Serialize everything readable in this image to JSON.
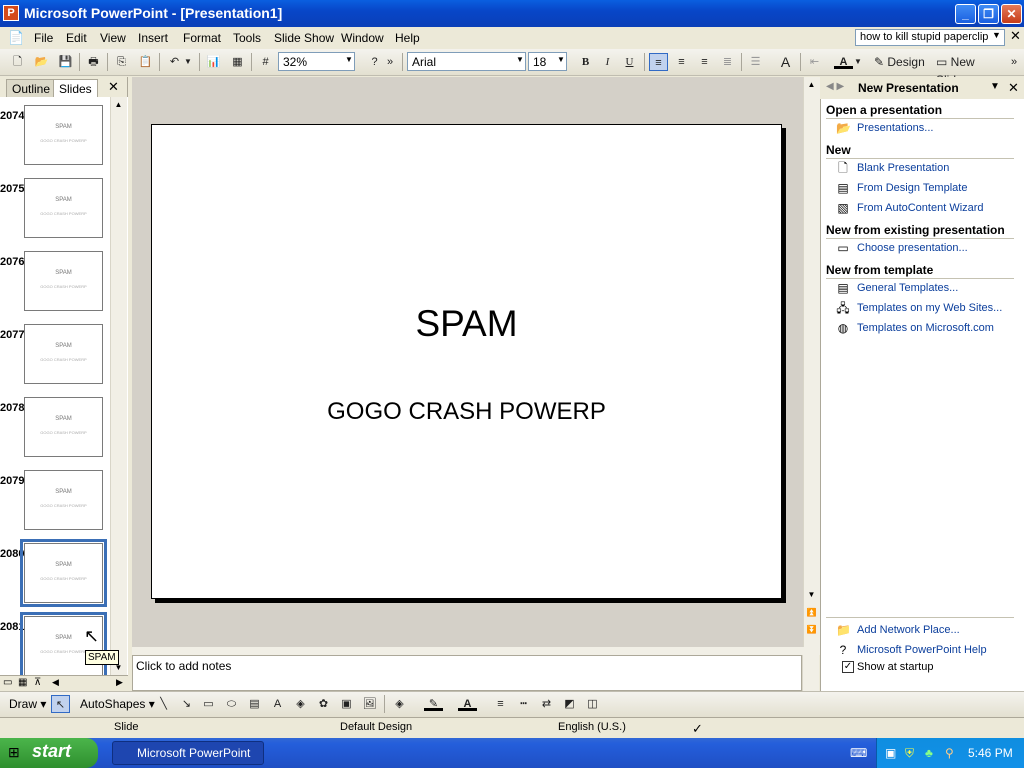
{
  "window": {
    "title": "Microsoft PowerPoint - [Presentation1]",
    "minimize": "_",
    "restore": "❐",
    "close": "✕"
  },
  "menu": {
    "items": [
      "File",
      "Edit",
      "View",
      "Insert",
      "Format",
      "Tools",
      "Slide Show",
      "Window",
      "Help"
    ],
    "ask_question": "how to kill stupid paperclip",
    "close_doc": "✕"
  },
  "toolbar": {
    "zoom": "32%",
    "font": "Arial",
    "size": "18",
    "bold": "B",
    "italic": "I",
    "underline": "U",
    "design": "Design",
    "new_slide": "New Slide",
    "more": "»"
  },
  "left_pane": {
    "tab_outline": "Outline",
    "tab_slides": "Slides",
    "close": "✕",
    "slides": [
      {
        "num": "2074",
        "title": "SPAM",
        "sub": "GOGO CRASH POWERP"
      },
      {
        "num": "2075",
        "title": "SPAM",
        "sub": "GOGO CRASH POWERP"
      },
      {
        "num": "2076",
        "title": "SPAM",
        "sub": "GOGO CRASH POWERP"
      },
      {
        "num": "2077",
        "title": "SPAM",
        "sub": "GOGO CRASH POWERP"
      },
      {
        "num": "2078",
        "title": "SPAM",
        "sub": "GOGO CRASH POWERP"
      },
      {
        "num": "2079",
        "title": "SPAM",
        "sub": "GOGO CRASH POWERP"
      },
      {
        "num": "2080",
        "title": "SPAM",
        "sub": "GOGO CRASH POWERP"
      },
      {
        "num": "2081",
        "title": "SPAM",
        "sub": "GOGO CRASH POWERP"
      }
    ],
    "tooltip": "SPAM"
  },
  "slide": {
    "title": "SPAM",
    "subtitle": "GOGO CRASH POWERP"
  },
  "notes": {
    "placeholder": "Click to add notes"
  },
  "task_pane": {
    "title": "New Presentation",
    "open_heading": "Open a presentation",
    "open_link": "Presentations...",
    "new_heading": "New",
    "new_links": [
      "Blank Presentation",
      "From Design Template",
      "From AutoContent Wizard"
    ],
    "existing_heading": "New from existing presentation",
    "existing_link": "Choose presentation...",
    "template_heading": "New from template",
    "template_links": [
      "General Templates...",
      "Templates on my Web Sites...",
      "Templates on Microsoft.com"
    ],
    "bottom_links": [
      "Add Network Place...",
      "Microsoft PowerPoint Help"
    ],
    "show_at_startup": "Show at startup",
    "show_at_startup_checked": true
  },
  "draw_toolbar": {
    "draw": "Draw",
    "autoshapes": "AutoShapes"
  },
  "status": {
    "slide": "Slide",
    "design": "Default Design",
    "language": "English (U.S.)"
  },
  "taskbar": {
    "start": "start",
    "app_button": "Microsoft PowerPoint ...",
    "clock": "5:46 PM"
  }
}
